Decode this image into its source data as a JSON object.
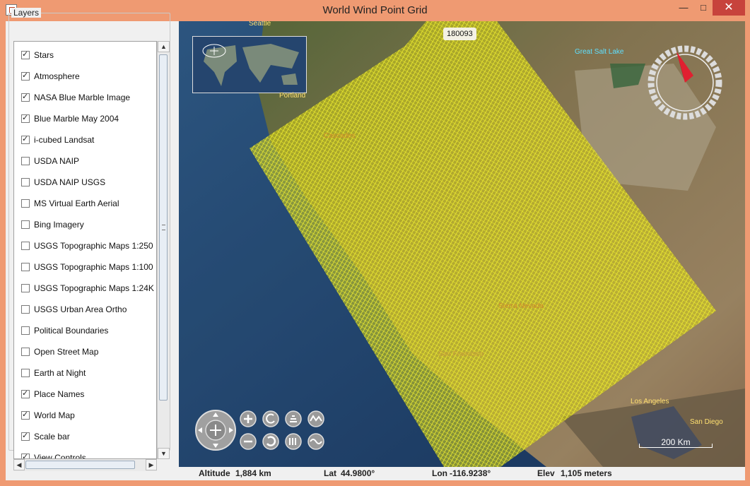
{
  "window": {
    "title": "World Wind Point Grid",
    "minimize_label": "—",
    "maximize_label": "□",
    "close_label": "✕"
  },
  "layers_panel": {
    "title": "Layers",
    "items": [
      {
        "label": "Stars",
        "checked": true
      },
      {
        "label": "Atmosphere",
        "checked": true
      },
      {
        "label": "NASA Blue Marble Image",
        "checked": true
      },
      {
        "label": "Blue Marble May 2004",
        "checked": true
      },
      {
        "label": "i-cubed Landsat",
        "checked": true
      },
      {
        "label": "USDA NAIP",
        "checked": false
      },
      {
        "label": "USDA NAIP USGS",
        "checked": false
      },
      {
        "label": "MS Virtual Earth Aerial",
        "checked": false
      },
      {
        "label": "Bing Imagery",
        "checked": false
      },
      {
        "label": "USGS Topographic Maps 1:250",
        "checked": false
      },
      {
        "label": "USGS Topographic Maps 1:100",
        "checked": false
      },
      {
        "label": "USGS Topographic Maps 1:24K",
        "checked": false
      },
      {
        "label": "USGS Urban Area Ortho",
        "checked": false
      },
      {
        "label": "Political Boundaries",
        "checked": false
      },
      {
        "label": "Open Street Map",
        "checked": false
      },
      {
        "label": "Earth at Night",
        "checked": false
      },
      {
        "label": "Place Names",
        "checked": true
      },
      {
        "label": "World Map",
        "checked": true
      },
      {
        "label": "Scale bar",
        "checked": true
      },
      {
        "label": "View Controls",
        "checked": true
      }
    ]
  },
  "map": {
    "grid_point_count": "180093",
    "place_names": {
      "seattle": "Seattle",
      "portland": "Portland",
      "great_salt_lake": "Great Salt Lake",
      "cascades": "Cascades",
      "sierra_nevada": "Sierra Nevada",
      "san_francisco": "San Francisco",
      "los_angeles": "Los Angeles",
      "san_diego": "San Diego"
    },
    "scale_bar_label": "200 Km"
  },
  "status": {
    "altitude_label": "Altitude",
    "altitude_value": "1,884 km",
    "lat_label": "Lat",
    "lat_value": "44.9800°",
    "lon_label": "Lon",
    "lon_value": "-116.9238°",
    "elev_label": "Elev",
    "elev_value": "1,105 meters"
  },
  "colors": {
    "grid_yellow": "#e6e61e",
    "title_bar": "#ef9a72",
    "close_button": "#c7433c"
  }
}
